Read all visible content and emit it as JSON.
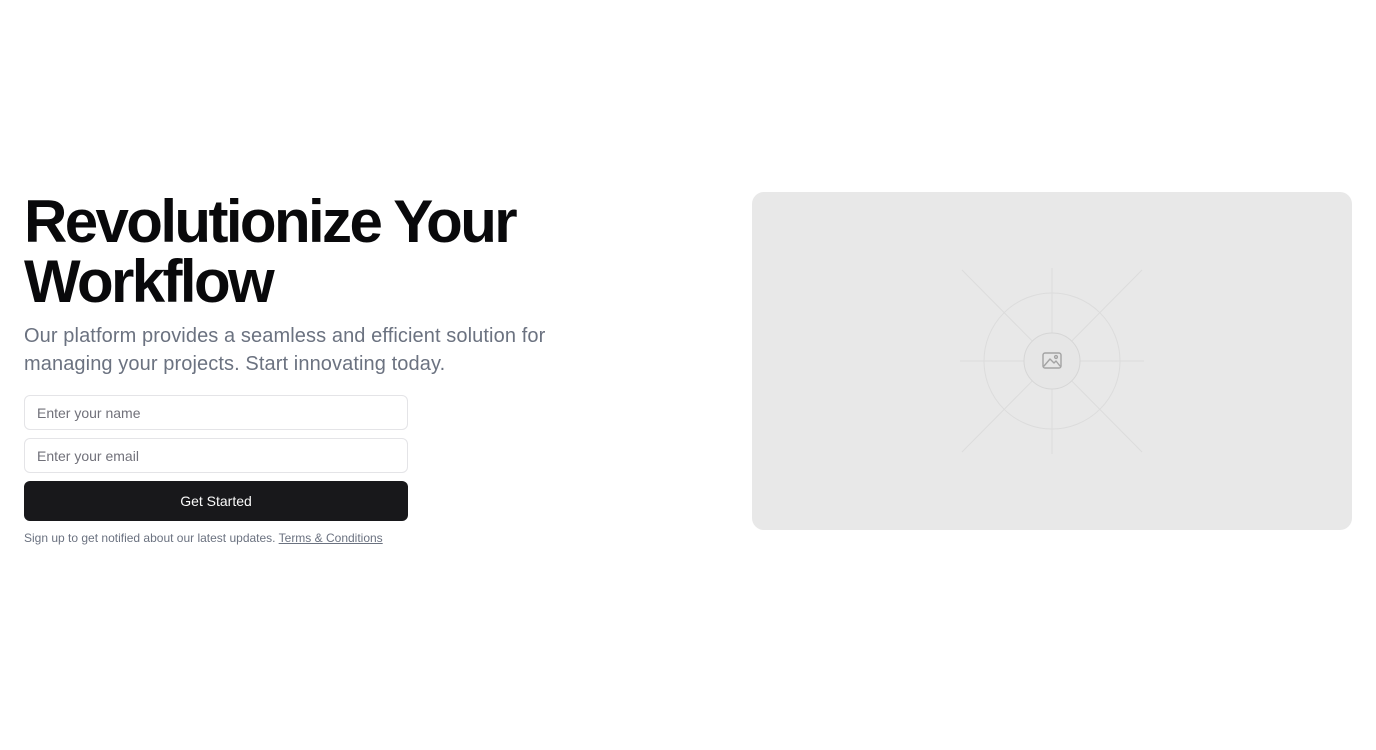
{
  "hero": {
    "title": "Revolutionize Your Workflow",
    "subtitle": "Our platform provides a seamless and efficient solution for managing your projects. Start innovating today."
  },
  "form": {
    "name_placeholder": "Enter your name",
    "email_placeholder": "Enter your email",
    "submit_label": "Get Started",
    "note_text": "Sign up to get notified about our latest updates.",
    "terms_link": "Terms & Conditions"
  },
  "media": {
    "icon": "image-icon",
    "background_color": "#e8e8e8"
  },
  "colors": {
    "button_bg": "#18181b",
    "title": "#09090b",
    "muted_text": "#6b7280",
    "input_border": "#e4e4e7"
  }
}
